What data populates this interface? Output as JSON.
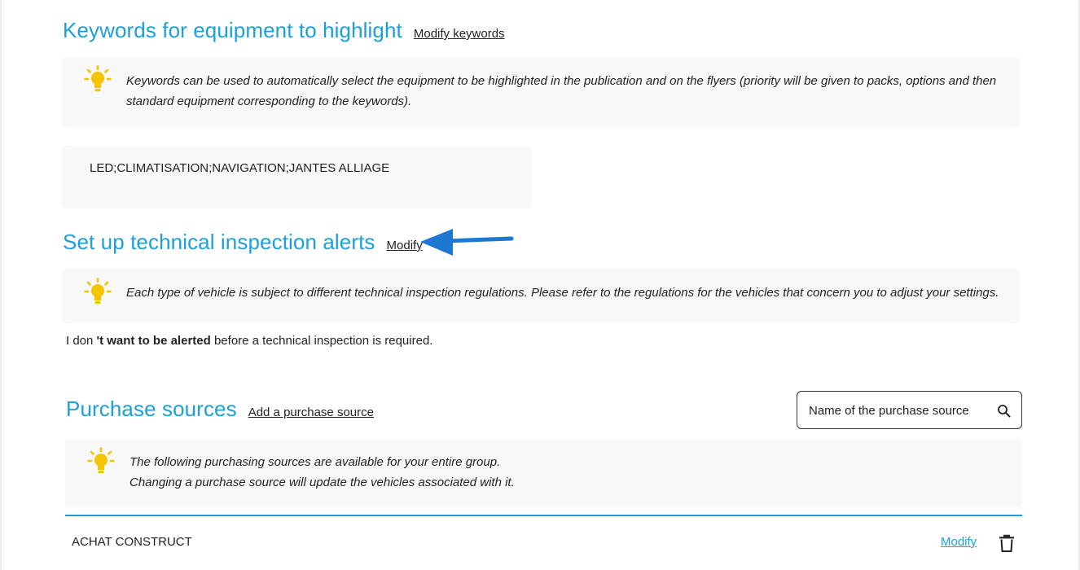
{
  "keywords_section": {
    "title": "Keywords for equipment to highlight",
    "modify_link": "Modify keywords",
    "info_text": "Keywords can be used to automatically select the equipment to be highlighted in the publication and on the flyers (priority will be given to packs, options and then standard equipment corresponding to the keywords).",
    "keywords_value": "LED;CLIMATISATION;NAVIGATION;JANTES ALLIAGE"
  },
  "inspection_section": {
    "title": "Set up technical inspection alerts",
    "modify_link": "Modify",
    "info_text": "Each type of vehicle is subject to different technical inspection regulations. Please refer to the regulations for the vehicles that concern you to adjust your settings.",
    "alert_prefix": "I don ",
    "alert_bold": "'t want to be alerted",
    "alert_suffix": " before a technical inspection is required."
  },
  "purchase_section": {
    "title": "Purchase sources",
    "add_link": "Add a purchase source",
    "search_placeholder": "Name of the purchase source",
    "info_line1": "The following purchasing sources are available for your entire group.",
    "info_line2": "Changing a purchase source will update the vehicles associated with it.",
    "rows": [
      {
        "name": "ACHAT CONSTRUCT",
        "modify_label": "Modify"
      }
    ]
  },
  "icons": {
    "bulb": "lightbulb-icon",
    "search": "search-icon",
    "delete": "trash-icon",
    "annotation": "arrow-icon"
  },
  "colors": {
    "accent": "#1ba0d9",
    "bulb": "#f5c400",
    "info_bg": "#f8f8f8",
    "arrow": "#1e78d2"
  }
}
